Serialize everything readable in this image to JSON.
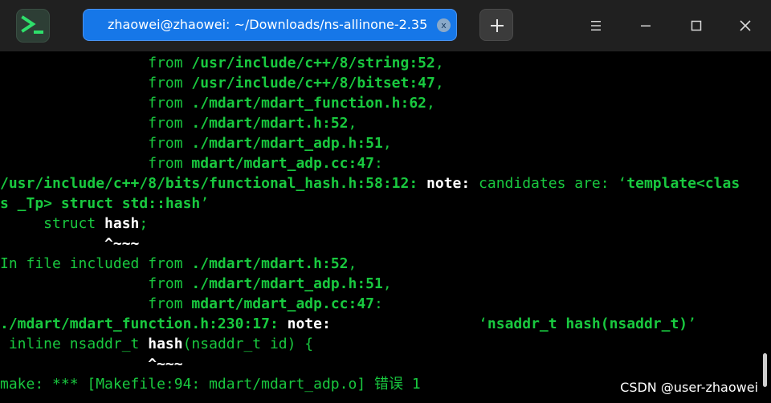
{
  "app": {
    "icon": "terminal-app-icon"
  },
  "tab": {
    "title": "zhaowei@zhaowei: ~/Downloads/ns-allinone-2.35",
    "close_label": "x"
  },
  "toolbar": {
    "new_tab_icon": "plus-icon",
    "menu_icon": "hamburger-menu-icon",
    "minimize_icon": "minimize-icon",
    "maximize_icon": "maximize-icon",
    "close_icon": "close-icon"
  },
  "colors": {
    "terminal_green": "#19c93f",
    "tab_accent": "#1677e8",
    "titlebar": "#202020"
  },
  "terminal": {
    "lines": [
      {
        "segments": [
          {
            "t": "                 from ",
            "s": ""
          },
          {
            "t": "/usr/include/c++/8/string:52",
            "s": "b"
          },
          {
            "t": ",",
            "s": ""
          }
        ]
      },
      {
        "segments": [
          {
            "t": "                 from ",
            "s": ""
          },
          {
            "t": "/usr/include/c++/8/bitset:47",
            "s": "b"
          },
          {
            "t": ",",
            "s": ""
          }
        ]
      },
      {
        "segments": [
          {
            "t": "                 from ",
            "s": ""
          },
          {
            "t": "./mdart/mdart_function.h:62",
            "s": "b"
          },
          {
            "t": ",",
            "s": ""
          }
        ]
      },
      {
        "segments": [
          {
            "t": "                 from ",
            "s": ""
          },
          {
            "t": "./mdart/mdart.h:52",
            "s": "b"
          },
          {
            "t": ",",
            "s": ""
          }
        ]
      },
      {
        "segments": [
          {
            "t": "                 from ",
            "s": ""
          },
          {
            "t": "./mdart/mdart_adp.h:51",
            "s": "b"
          },
          {
            "t": ",",
            "s": ""
          }
        ]
      },
      {
        "segments": [
          {
            "t": "                 from ",
            "s": ""
          },
          {
            "t": "mdart/mdart_adp.cc:47",
            "s": "b"
          },
          {
            "t": ":",
            "s": ""
          }
        ]
      },
      {
        "segments": [
          {
            "t": "/usr/include/c++/8/bits/functional_hash.h:58:12: ",
            "s": "b"
          },
          {
            "t": "note:",
            "s": "w"
          },
          {
            "t": " candidates are: ‘",
            "s": ""
          },
          {
            "t": "template<clas",
            "s": "b"
          }
        ]
      },
      {
        "segments": [
          {
            "t": "s _Tp> struct std::hash",
            "s": "b"
          },
          {
            "t": "’",
            "s": ""
          }
        ]
      },
      {
        "segments": [
          {
            "t": "     struct ",
            "s": ""
          },
          {
            "t": "hash",
            "s": "w"
          },
          {
            "t": ";",
            "s": ""
          }
        ]
      },
      {
        "segments": [
          {
            "t": "            ^~~~",
            "s": "w"
          }
        ]
      },
      {
        "segments": [
          {
            "t": "In file included from ",
            "s": ""
          },
          {
            "t": "./mdart/mdart.h:52",
            "s": "b"
          },
          {
            "t": ",",
            "s": ""
          }
        ]
      },
      {
        "segments": [
          {
            "t": "                 from ",
            "s": ""
          },
          {
            "t": "./mdart/mdart_adp.h:51",
            "s": "b"
          },
          {
            "t": ",",
            "s": ""
          }
        ]
      },
      {
        "segments": [
          {
            "t": "                 from ",
            "s": ""
          },
          {
            "t": "mdart/mdart_adp.cc:47",
            "s": "b"
          },
          {
            "t": ":",
            "s": ""
          }
        ]
      },
      {
        "segments": [
          {
            "t": "./mdart/mdart_function.h:230:17: ",
            "s": "b"
          },
          {
            "t": "note:",
            "s": "w"
          },
          {
            "t": "                 ‘",
            "s": ""
          },
          {
            "t": "nsaddr_t hash(nsaddr_t)",
            "s": "b"
          },
          {
            "t": "’",
            "s": ""
          }
        ]
      },
      {
        "segments": [
          {
            "t": " inline nsaddr_t ",
            "s": ""
          },
          {
            "t": "hash",
            "s": "w"
          },
          {
            "t": "(nsaddr_t id) {",
            "s": ""
          }
        ]
      },
      {
        "segments": [
          {
            "t": "                 ^~~~",
            "s": "w"
          }
        ]
      },
      {
        "segments": [
          {
            "t": "make: *** [Makefile:94: mdart/mdart_adp.o] 错误 1",
            "s": ""
          }
        ]
      }
    ]
  },
  "watermark": "CSDN @user-zhaowei"
}
